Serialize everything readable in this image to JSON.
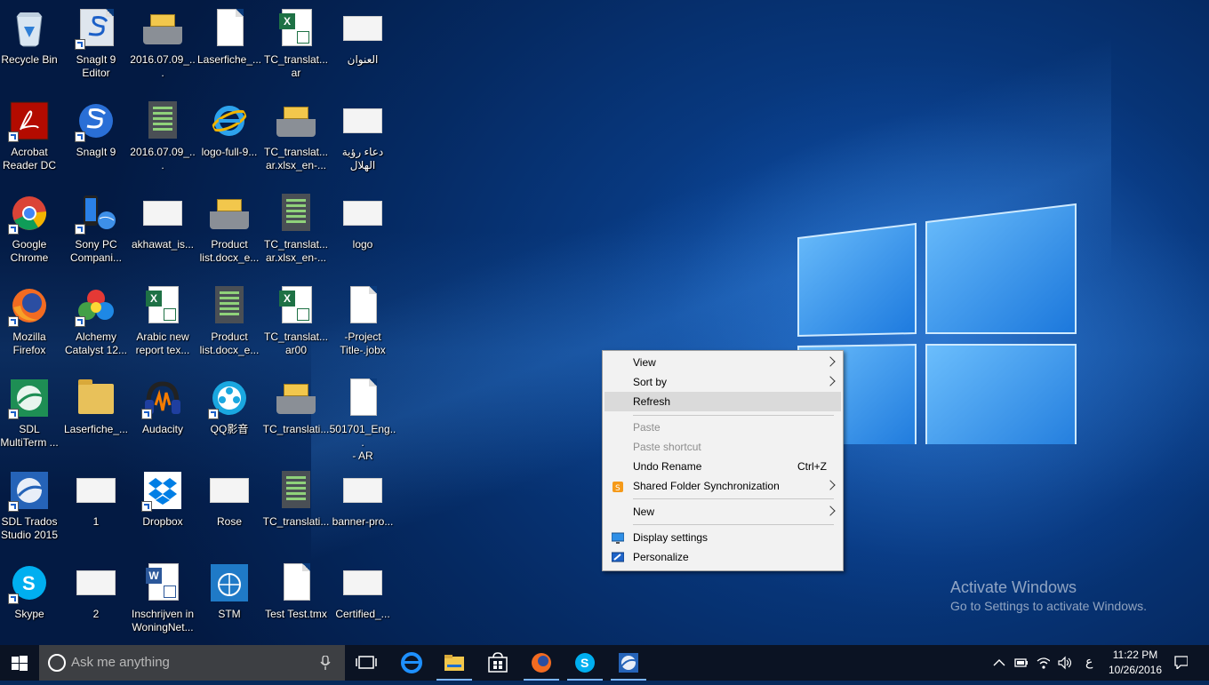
{
  "desktop": {
    "icons": [
      {
        "label": "Recycle Bin",
        "kind": "recycle-bin-icon"
      },
      {
        "label": "SnagIt 9\nEditor",
        "kind": "snagit-editor-icon"
      },
      {
        "label": "2016.07.09_...",
        "kind": "file-tray-icon"
      },
      {
        "label": "Laserfiche_...",
        "kind": "document-icon"
      },
      {
        "label": "TC_translat...\nar",
        "kind": "excel-icon"
      },
      {
        "label": "العنوان",
        "kind": "image-thumbnail-icon"
      },
      {
        "label": "Acrobat\nReader DC",
        "kind": "acrobat-icon"
      },
      {
        "label": "SnagIt 9",
        "kind": "snagit-icon"
      },
      {
        "label": "2016.07.09_...",
        "kind": "text-document-icon"
      },
      {
        "label": "logo-full-9...",
        "kind": "internet-explorer-icon"
      },
      {
        "label": "TC_translat...\nar.xlsx_en-...",
        "kind": "file-tray-icon"
      },
      {
        "label": "دعاء رؤية\nالهلال",
        "kind": "image-thumbnail-icon"
      },
      {
        "label": "Google\nChrome",
        "kind": "chrome-icon"
      },
      {
        "label": "Sony PC\nCompani...",
        "kind": "sony-pc-companion-icon"
      },
      {
        "label": "akhawat_is...",
        "kind": "image-thumbnail-icon"
      },
      {
        "label": "Product\nlist.docx_e...",
        "kind": "file-tray-icon"
      },
      {
        "label": "TC_translat...\nar.xlsx_en-...",
        "kind": "text-document-icon"
      },
      {
        "label": "logo",
        "kind": "image-thumbnail-icon"
      },
      {
        "label": "Mozilla\nFirefox",
        "kind": "firefox-icon"
      },
      {
        "label": "Alchemy\nCatalyst 12...",
        "kind": "alchemy-catalyst-icon"
      },
      {
        "label": "Arabic new\nreport tex...",
        "kind": "excel-icon"
      },
      {
        "label": "Product\nlist.docx_e...",
        "kind": "text-document-icon"
      },
      {
        "label": "TC_translat...\nar00",
        "kind": "excel-icon"
      },
      {
        "label": "-Project\nTitle-.jobx",
        "kind": "document-icon"
      },
      {
        "label": "SDL\nMultiTerm ...",
        "kind": "sdl-multiterm-icon"
      },
      {
        "label": "Laserfiche_...",
        "kind": "folder-icon"
      },
      {
        "label": "Audacity",
        "kind": "audacity-icon"
      },
      {
        "label": "QQ影音",
        "kind": "qq-player-icon"
      },
      {
        "label": "TC_translati...",
        "kind": "file-tray-icon"
      },
      {
        "label": "501701_Eng...\n- AR",
        "kind": "document-icon"
      },
      {
        "label": "SDL Trados\nStudio 2015",
        "kind": "sdl-trados-icon"
      },
      {
        "label": "1",
        "kind": "image-thumbnail-icon"
      },
      {
        "label": "Dropbox",
        "kind": "dropbox-icon"
      },
      {
        "label": "Rose",
        "kind": "image-thumbnail-icon"
      },
      {
        "label": "TC_translati...",
        "kind": "text-document-icon"
      },
      {
        "label": "banner-pro...",
        "kind": "image-thumbnail-icon"
      },
      {
        "label": "Skype",
        "kind": "skype-icon"
      },
      {
        "label": "2",
        "kind": "image-thumbnail-icon"
      },
      {
        "label": "Inschrijven in\nWoningNet...",
        "kind": "word-icon"
      },
      {
        "label": "STM",
        "kind": "wfp-icon"
      },
      {
        "label": "Test Test.tmx",
        "kind": "document-icon"
      },
      {
        "label": "Certified_...",
        "kind": "image-thumbnail-icon"
      }
    ]
  },
  "context_menu": {
    "items": [
      {
        "label": "View",
        "submenu": true
      },
      {
        "label": "Sort by",
        "submenu": true
      },
      {
        "label": "Refresh",
        "highlighted": true
      },
      {
        "label": "Paste",
        "disabled": true
      },
      {
        "label": "Paste shortcut",
        "disabled": true
      },
      {
        "label": "Undo Rename",
        "shortcut": "Ctrl+Z"
      },
      {
        "label": "Shared Folder Synchronization",
        "submenu": true,
        "icon": "sync-icon"
      },
      {
        "label": "New",
        "submenu": true
      },
      {
        "label": "Display settings",
        "icon": "display-icon"
      },
      {
        "label": "Personalize",
        "icon": "personalize-icon"
      }
    ]
  },
  "watermark": {
    "title": "Activate Windows",
    "subtitle": "Go to Settings to activate Windows."
  },
  "taskbar": {
    "search_placeholder": "Ask me anything",
    "pinned": [
      "task-view-icon",
      "edge-icon",
      "file-explorer-icon",
      "store-icon",
      "firefox-icon",
      "skype-icon",
      "sdl-icon"
    ],
    "tray": {
      "language": "ع",
      "time": "11:22 PM",
      "date": "10/26/2016"
    }
  },
  "colors": {
    "accent": "#0078d7",
    "menu_bg": "#f2f2f2",
    "menu_highlight": "#dadada",
    "taskbar_bg": "#0b1323"
  }
}
